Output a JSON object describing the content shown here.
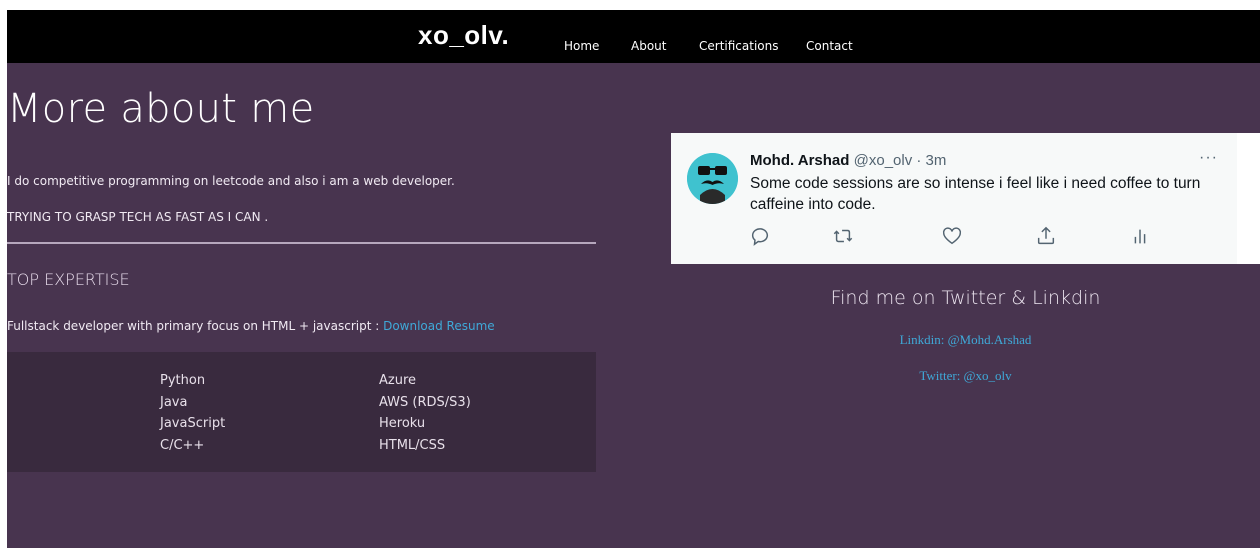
{
  "nav": {
    "brand": "xo_olv.",
    "items": [
      "Home",
      "About",
      "Certifications",
      "Contact"
    ]
  },
  "about": {
    "title": "More about me",
    "line1": "I do competitive programming on leetcode and also i am a web developer.",
    "line2": "TRYING TO GRASP TECH AS FAST AS I CAN ."
  },
  "expertise": {
    "heading": "TOP EXPERTISE",
    "text": "Fullstack developer with primary focus on HTML + javascript : ",
    "resume_link": "Download Resume",
    "left_skills": [
      "Python",
      "Java",
      "JavaScript",
      "C/C++"
    ],
    "right_skills": [
      "Azure",
      "AWS (RDS/S3)",
      "Heroku",
      "HTML/CSS"
    ]
  },
  "tweet": {
    "name": "Mohd. Arshad",
    "handle_time": "@xo_olv · 3m",
    "more": "···",
    "text": "Some code sessions are so intense i feel like i need coffee to turn caffeine into code.",
    "actions": [
      "reply-icon",
      "retweet-icon",
      "like-icon",
      "share-icon",
      "analytics-icon"
    ]
  },
  "social": {
    "heading": "Find me on Twitter & Linkdin",
    "linkedin": "Linkdin: @Mohd.Arshad",
    "twitter": "Twitter: @xo_olv"
  },
  "colors": {
    "page_bg": "#48344f",
    "navbar_bg": "#000000",
    "skills_bg": "#392a3e",
    "link": "#3fa9d8",
    "avatar": "#3fc2cf"
  }
}
